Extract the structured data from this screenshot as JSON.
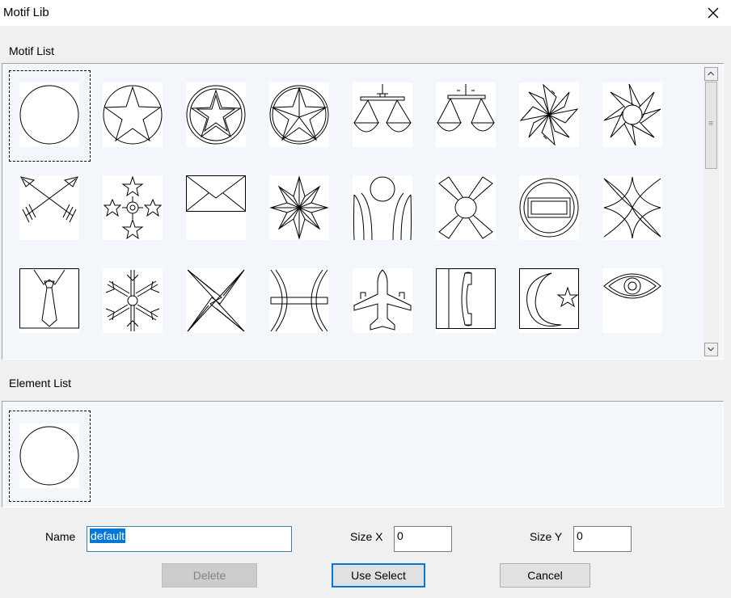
{
  "window": {
    "title": "Motif Lib"
  },
  "motif_list": {
    "label": "Motif List",
    "selected": "circle",
    "items": [
      {
        "icon": "circle"
      },
      {
        "icon": "star-in-circle"
      },
      {
        "icon": "star-in-double-circle"
      },
      {
        "icon": "faceted-star-in-circle"
      },
      {
        "icon": "scales"
      },
      {
        "icon": "scales-simple"
      },
      {
        "icon": "pinwheel"
      },
      {
        "icon": "sun-star"
      },
      {
        "icon": "crossed-arrows"
      },
      {
        "icon": "star-cluster"
      },
      {
        "icon": "envelope"
      },
      {
        "icon": "compass-star"
      },
      {
        "icon": "figure-arches"
      },
      {
        "icon": "sun-kites"
      },
      {
        "icon": "rounded-frame"
      },
      {
        "icon": "four-point-cross"
      },
      {
        "icon": "necktie"
      },
      {
        "icon": "snowflake"
      },
      {
        "icon": "pinwheel-star"
      },
      {
        "icon": "pisces"
      },
      {
        "icon": "airplane"
      },
      {
        "icon": "telephone"
      },
      {
        "icon": "crescent-star"
      },
      {
        "icon": "eye"
      }
    ]
  },
  "element_list": {
    "label": "Element List",
    "items": [
      {
        "icon": "circle"
      }
    ]
  },
  "form": {
    "name_label": "Name",
    "name_value": "default",
    "size_x_label": "Size X",
    "size_x_value": "0",
    "size_y_label": "Size Y",
    "size_y_value": "0"
  },
  "buttons": {
    "delete": "Delete",
    "use_select": "Use Select",
    "cancel": "Cancel"
  },
  "colors": {
    "selection": "#0078d7",
    "panel": "#f3f6fa"
  }
}
